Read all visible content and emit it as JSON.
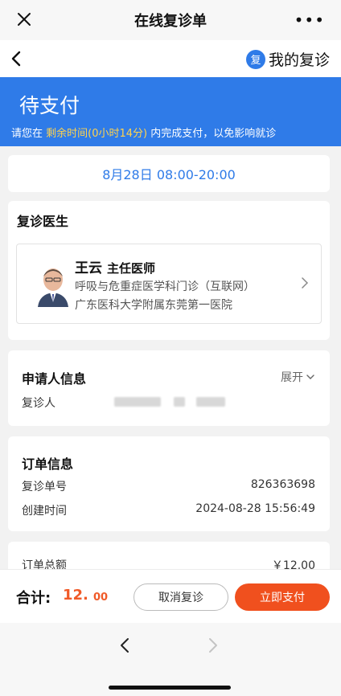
{
  "window": {
    "title": "在线复诊单",
    "more": "•••"
  },
  "nav": {
    "brand_logo": "复",
    "brand_name": "我的复诊"
  },
  "banner": {
    "status": "待支付",
    "notice_prefix": "请您在",
    "notice_highlight": "剩余时间(0小时14分)",
    "notice_suffix": "内完成支付，以免影响就诊"
  },
  "appointment": {
    "time": "8月28日 08:00-20:00"
  },
  "doctor": {
    "section_title": "复诊医生",
    "name": "王云",
    "title": "主任医师",
    "department": "呼吸与危重症医学科门诊（互联网）",
    "hospital": "广东医科大学附属东莞第一医院"
  },
  "applicant": {
    "section_title": "申请人信息",
    "expand_label": "展开",
    "patient_label": "复诊人"
  },
  "order": {
    "section_title": "订单信息",
    "rows": [
      {
        "label": "复诊单号",
        "value": "826363698"
      },
      {
        "label": "创建时间",
        "value": "2024-08-28 15:56:49"
      }
    ],
    "total_label": "订单总额",
    "total_value": "￥12.00"
  },
  "footer": {
    "total_label": "合计:",
    "total_int": "12.",
    "total_dec": "00",
    "cancel_label": "取消复诊",
    "pay_label": "立即支付"
  },
  "colors": {
    "primary": "#2f7be8",
    "accent": "#f0501e",
    "highlight": "#ffd34d"
  }
}
